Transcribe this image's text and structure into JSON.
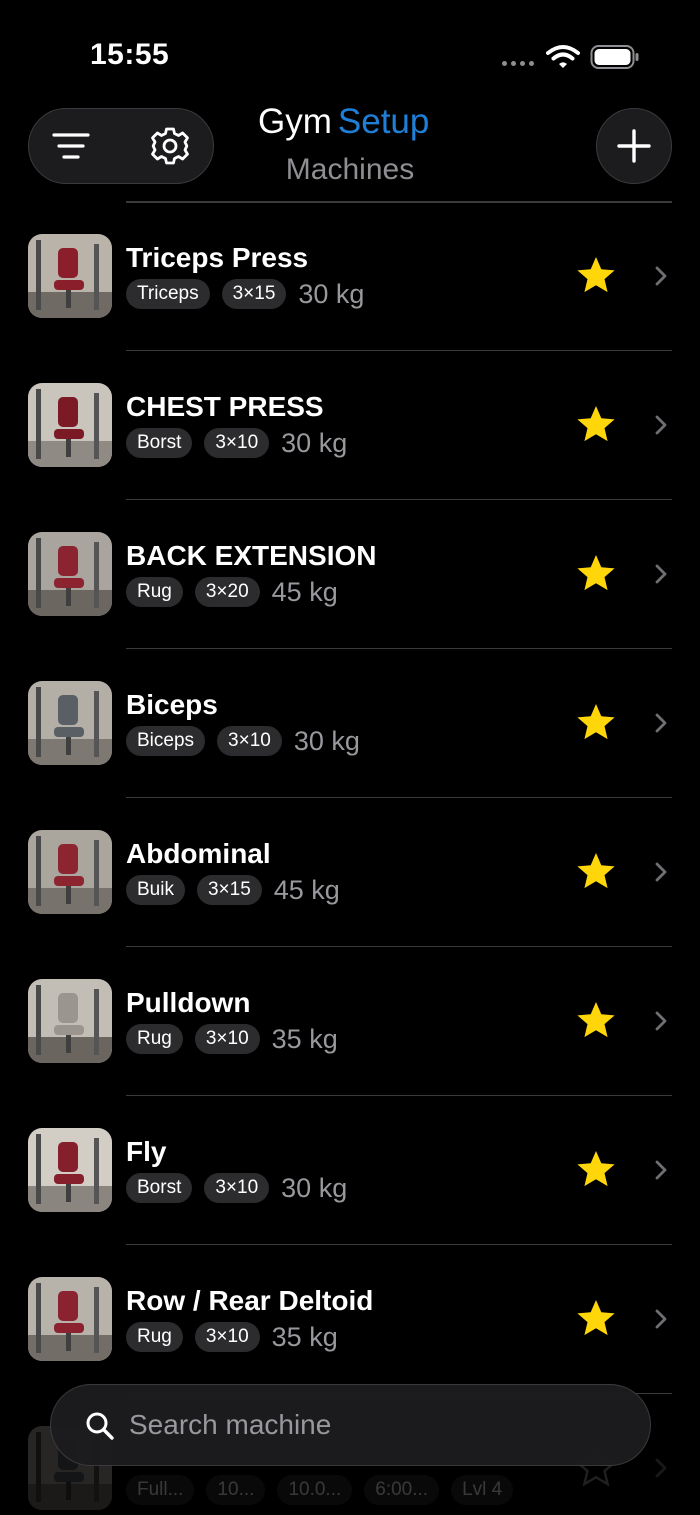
{
  "status_bar": {
    "time": "15:55"
  },
  "header": {
    "title_part1": "Gym",
    "title_part2": "Setup",
    "subtitle": "Machines",
    "accent_color": "#1f7fd6",
    "icons": {
      "menu": "filter-lines-icon",
      "settings": "gear-icon",
      "add": "plus-icon"
    }
  },
  "machines": [
    {
      "name": "Triceps Press",
      "category": "Triceps",
      "sets": "3×15",
      "weight": "30 kg",
      "favorite": true
    },
    {
      "name": "CHEST PRESS",
      "category": "Borst",
      "sets": "3×10",
      "weight": "30 kg",
      "favorite": true
    },
    {
      "name": "BACK EXTENSION",
      "category": "Rug",
      "sets": "3×20",
      "weight": "45 kg",
      "favorite": true
    },
    {
      "name": "Biceps",
      "category": "Biceps",
      "sets": "3×10",
      "weight": "30 kg",
      "favorite": true
    },
    {
      "name": "Abdominal",
      "category": "Buik",
      "sets": "3×15",
      "weight": "45 kg",
      "favorite": true
    },
    {
      "name": "Pulldown",
      "category": "Rug",
      "sets": "3×10",
      "weight": "35 kg",
      "favorite": true
    },
    {
      "name": "Fly",
      "category": "Borst",
      "sets": "3×10",
      "weight": "30 kg",
      "favorite": true
    },
    {
      "name": "Row / Rear Deltoid",
      "category": "Rug",
      "sets": "3×10",
      "weight": "35 kg",
      "favorite": true
    }
  ],
  "partial_row": {
    "chips": [
      "Full...",
      "10...",
      "10.0...",
      "6:00...",
      "Lvl 4"
    ]
  },
  "search": {
    "placeholder": "Search machine",
    "value": ""
  },
  "colors": {
    "star": "#ffd60a",
    "background": "#000000"
  }
}
